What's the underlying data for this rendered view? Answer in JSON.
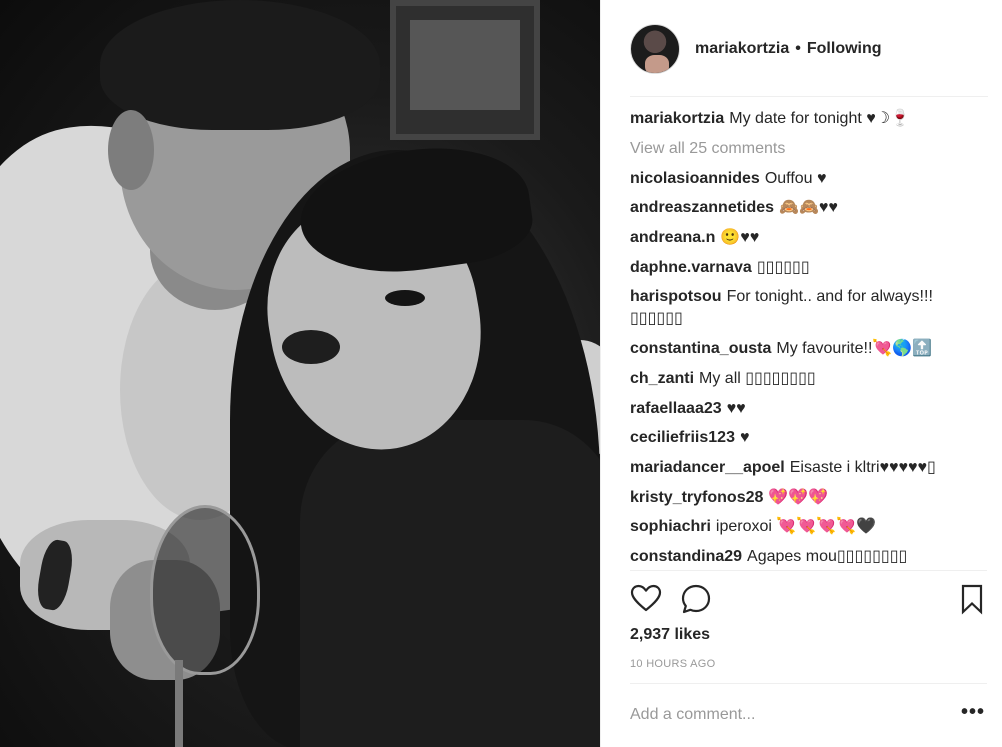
{
  "post": {
    "author": "mariakortzia",
    "follow_status": "Following",
    "separator": "•",
    "caption_user": "mariakortzia",
    "caption_text": "My date for tonight ♥☽🍷"
  },
  "view_all_comments": "View all 25 comments",
  "comments": [
    {
      "user": "nicolasioannides",
      "text": "Ouffou ♥"
    },
    {
      "user": "andreaszannetides",
      "text": "🙈🙈♥♥"
    },
    {
      "user": "andreana.n",
      "text": "🙂♥♥"
    },
    {
      "user": "daphne.varnava",
      "text": "▯▯▯▯▯▯"
    },
    {
      "user": "harispotsou",
      "text": "For tonight.. and for always!!! ▯▯▯▯▯▯"
    },
    {
      "user": "constantina_ousta",
      "text": "My favourite!!💘🌎🔝"
    },
    {
      "user": "ch_zanti",
      "text": "My all ▯▯▯▯▯▯▯▯"
    },
    {
      "user": "rafaellaaa23",
      "text": "♥♥"
    },
    {
      "user": "ceciliefriis123",
      "text": "♥"
    },
    {
      "user": "mariadancer__apoel",
      "text": "Eisaste i kltri♥♥♥♥♥▯"
    },
    {
      "user": "kristy_tryfonos28",
      "text": "💖💖💖"
    },
    {
      "user": "sophiachri",
      "text": "iperoxoi 💘💘💘💘🖤"
    },
    {
      "user": "constandina29",
      "text": "Agapes mou▯▯▯▯▯▯▯▯"
    }
  ],
  "likes": "2,937 likes",
  "timestamp": "10 HOURS AGO",
  "add_comment_placeholder": "Add a comment...",
  "more_options": "•••",
  "icons": {
    "like": "heart-icon",
    "comment": "comment-icon",
    "save": "bookmark-icon",
    "more": "more-options-icon"
  }
}
